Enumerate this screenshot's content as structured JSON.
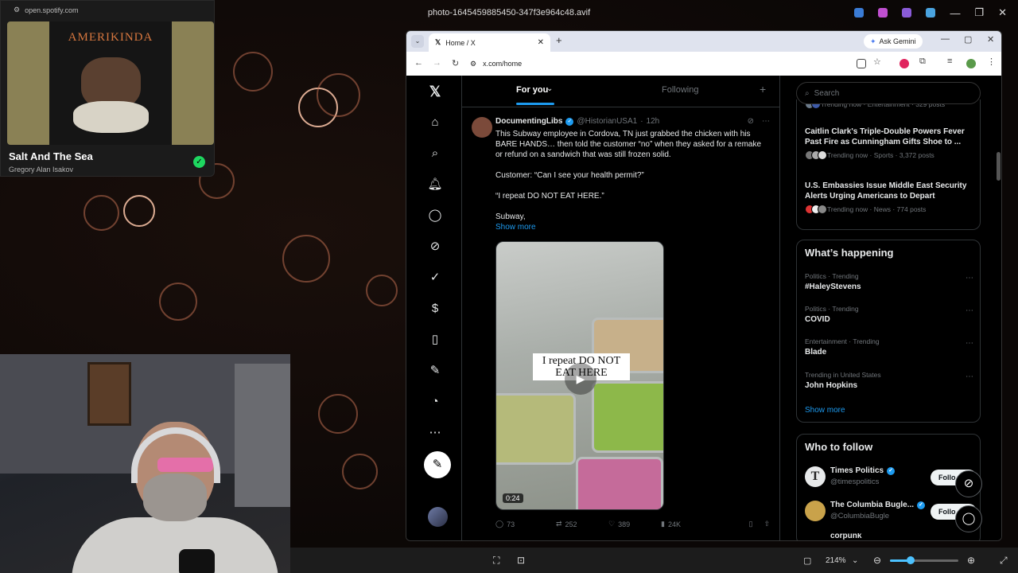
{
  "viewer": {
    "title": "photo-1645459885450-347f3e964c48.avif",
    "zoom": "214%",
    "controls": [
      "—",
      "❐",
      "✕"
    ]
  },
  "spotify": {
    "url": "open.spotify.com",
    "album_art_text": "AMERIKINDA",
    "track": "Salt And The Sea",
    "artist": "Gregory Alan Isakov"
  },
  "browser": {
    "tab_title": "Home / X",
    "url": "x.com/home",
    "gemini_label": "Ask Gemini"
  },
  "x": {
    "tabs": {
      "for_you": "For you",
      "following": "Following"
    },
    "tweet": {
      "name": "DocumentingLibs",
      "handle": "@HistorianUSA1",
      "time": "12h",
      "p1": "This Subway employee in Cordova, TN just grabbed the chicken with his BARE HANDS… then told the customer “no” when they asked for a remake or refund on a sandwich that was still frozen solid.",
      "p2": "Customer: “Can I see your health permit?”",
      "p3": "“I repeat DO NOT EAT HERE.”",
      "p4": "Subway,",
      "show_more": "Show more",
      "caption": "I repeat DO NOT EAT HERE",
      "duration": "0:24",
      "replies": "73",
      "reposts": "252",
      "likes": "389",
      "views": "24K"
    },
    "search_placeholder": "Search",
    "top_news": [
      {
        "title": "",
        "meta": "Trending now · Entertainment · 329 posts"
      },
      {
        "title": "Caitlin Clark's Triple-Double Powers Fever Past Fire as Cunningham Gifts Shoe to ...",
        "meta": "Trending now · Sports · 3,372 posts"
      },
      {
        "title": "U.S. Embassies Issue Middle East Security Alerts Urging Americans to Depart",
        "meta": "Trending now · News · 774 posts"
      }
    ],
    "happening": {
      "heading": "What’s happening",
      "items": [
        {
          "context": "Politics · Trending",
          "name": "#HaleyStevens"
        },
        {
          "context": "Politics · Trending",
          "name": "COVID"
        },
        {
          "context": "Entertainment · Trending",
          "name": "Blade"
        },
        {
          "context": "Trending in United States",
          "name": "John Hopkins"
        }
      ],
      "show_more": "Show more"
    },
    "who_to_follow": {
      "heading": "Who to follow",
      "accounts": [
        {
          "name": "Times Politics",
          "handle": "@timespolitics",
          "button": "Follo"
        },
        {
          "name": "The Columbia Bugle...",
          "handle": "@ColumbiaBugle",
          "button": "Follo"
        },
        {
          "name": "corpunk",
          "handle": "",
          "button": ""
        }
      ]
    }
  }
}
